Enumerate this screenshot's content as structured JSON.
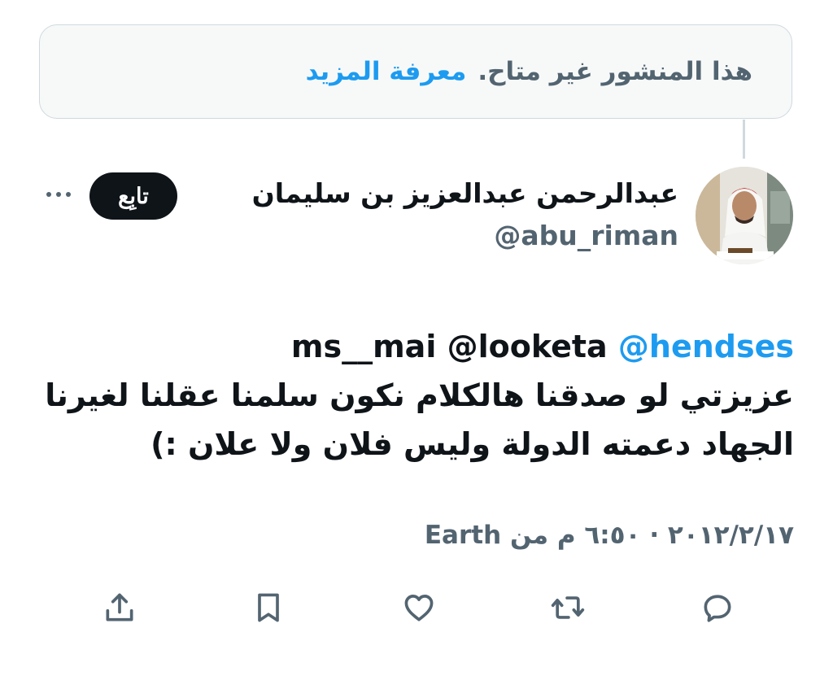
{
  "notice": {
    "text": "هذا المنشور غير متاح.",
    "link": "معرفة المزيد"
  },
  "author": {
    "name": "عبدالرحمن عبدالعزيز بن سليمان",
    "handle": "@abu_riman"
  },
  "follow_label": "تابِع",
  "tweet": {
    "mention_1": "@hendses",
    "mention_2": "@looketa",
    "mention_3": "ms__mai",
    "line_1": "عزيزتي لو صدقنا هالكلام نكون سلمنا عقلنا لغيرنا",
    "line_2": "الجهاد دعمته الدولة وليس فلان ولا علان :)"
  },
  "meta": {
    "date": "٢٠١٢/٢/١٧",
    "time": "٦:٥٠ م",
    "source_prefix": "من",
    "source": "Earth"
  },
  "icons": {
    "reply": "reply-icon",
    "retweet": "retweet-icon",
    "like": "heart-icon",
    "bookmark": "bookmark-icon",
    "share": "share-icon",
    "more": "more-icon"
  },
  "colors": {
    "accent": "#1d9bf0",
    "secondary_text": "#536471",
    "primary_text": "#0f1419",
    "border": "#cfd9de",
    "notice_bg": "#f7f9f9"
  }
}
